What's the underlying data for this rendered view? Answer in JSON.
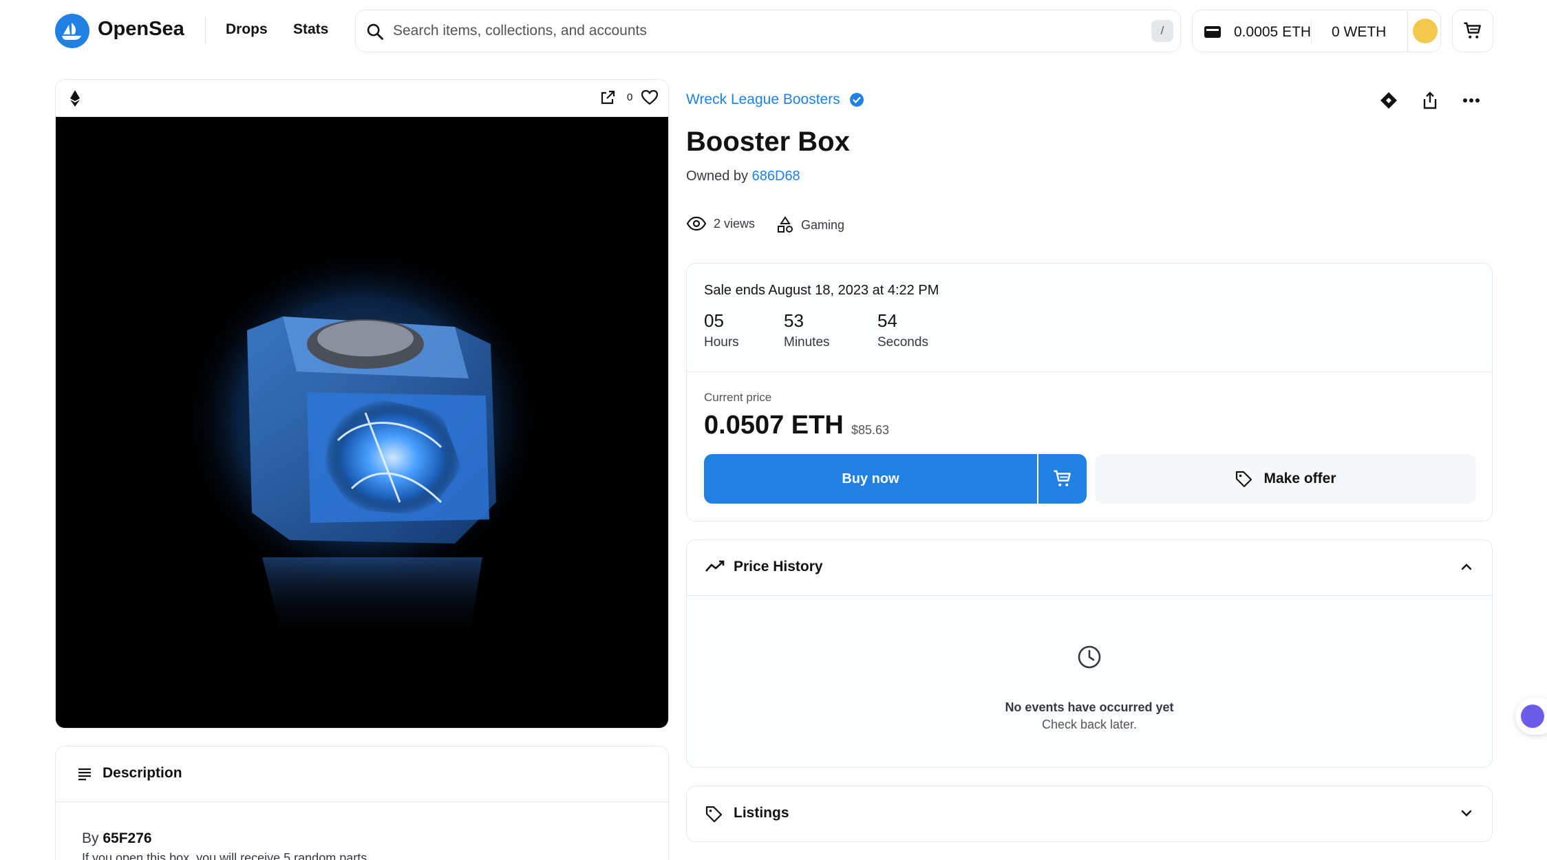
{
  "header": {
    "brand": "OpenSea",
    "nav": [
      "Drops",
      "Stats"
    ],
    "search_placeholder": "Search items, collections, and accounts",
    "search_shortcut": "/",
    "wallet_eth": "0.0005 ETH",
    "wallet_weth": "0 WETH"
  },
  "media": {
    "favorites_count": "0"
  },
  "description": {
    "title": "Description",
    "by_label": "By",
    "creator": "65F276",
    "text": "If you open this box, you will receive 5 random parts"
  },
  "item": {
    "collection": "Wreck League Boosters",
    "title": "Booster Box",
    "owned_by_label": "Owned by",
    "owner": "686D68",
    "views": "2 views",
    "category": "Gaming"
  },
  "sale": {
    "ends": "Sale ends August 18, 2023 at 4:22 PM",
    "countdown": [
      {
        "value": "05",
        "label": "Hours"
      },
      {
        "value": "53",
        "label": "Minutes"
      },
      {
        "value": "54",
        "label": "Seconds"
      }
    ],
    "current_price_label": "Current price",
    "price": "0.0507 ETH",
    "price_usd": "$85.63",
    "buy_label": "Buy now",
    "offer_label": "Make offer"
  },
  "price_history": {
    "title": "Price History",
    "empty_title": "No events have occurred yet",
    "empty_subtitle": "Check back later."
  },
  "listings": {
    "title": "Listings"
  },
  "colors": {
    "accent": "#2081e2",
    "text": "#121212",
    "border": "#e5e8eb"
  }
}
